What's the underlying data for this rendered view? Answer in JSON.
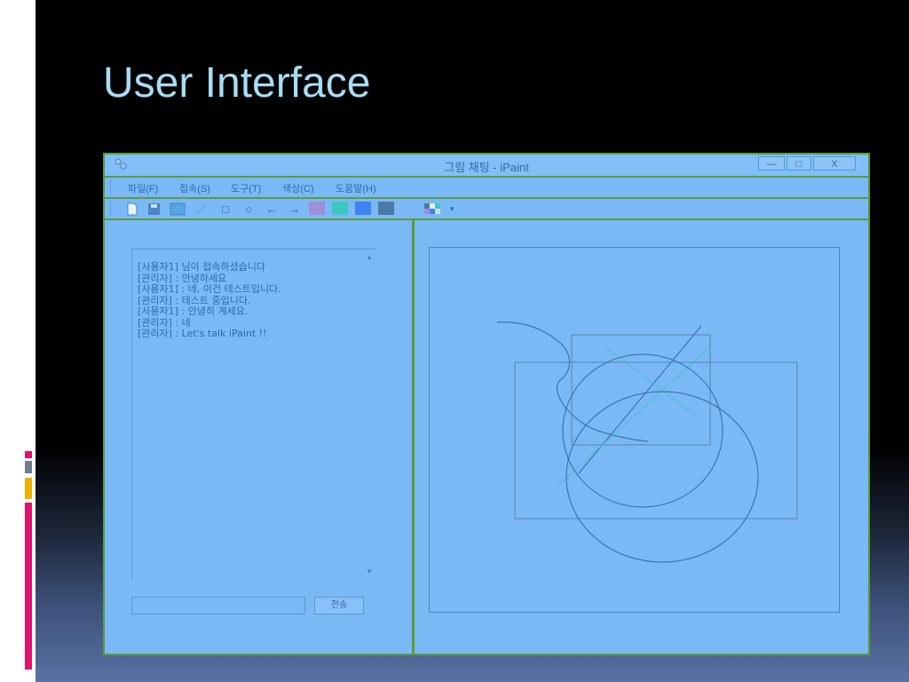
{
  "slide": {
    "title": "User Interface"
  },
  "window": {
    "title": "그림 채팅 - iPaint",
    "controls": {
      "minimize": "—",
      "maximize": "□",
      "close": "X"
    }
  },
  "menu": {
    "items": [
      {
        "label": "파일(F)"
      },
      {
        "label": "접속(S)"
      },
      {
        "label": "도구(T)"
      },
      {
        "label": "색상(C)"
      },
      {
        "label": "도움말(H)"
      }
    ]
  },
  "toolbar": {
    "tools": [
      "new-file",
      "save",
      "color-picker",
      "pen",
      "rectangle",
      "ellipse",
      "arrow-left",
      "arrow-right"
    ],
    "glyphs": {
      "rectangle": "□",
      "ellipse": "○",
      "arrow_left": "←",
      "arrow_right": "→"
    },
    "colors": [
      "#9e8fd6",
      "#3ec8c2",
      "#3f82f2",
      "#4a7aa6"
    ]
  },
  "chat": {
    "messages": [
      "[사용자1] 님이 접속하셨습니다",
      "[관리자] : 안녕하세요",
      "[사용자1] : 네, 이건 테스트입니다.",
      "[관리자] : 테스트 중입니다.",
      "[사용자1] : 안녕히 계세요.",
      "[관리자] : 네",
      "[관리자] : Let's talk iPaint !!"
    ],
    "input_value": "",
    "send_label": "전송"
  },
  "canvas": {
    "stroke_color": "#2f6aa6",
    "shapes": [
      "freehand-curve",
      "line",
      "line",
      "rectangle",
      "rectangle",
      "ellipse",
      "ellipse"
    ]
  }
}
